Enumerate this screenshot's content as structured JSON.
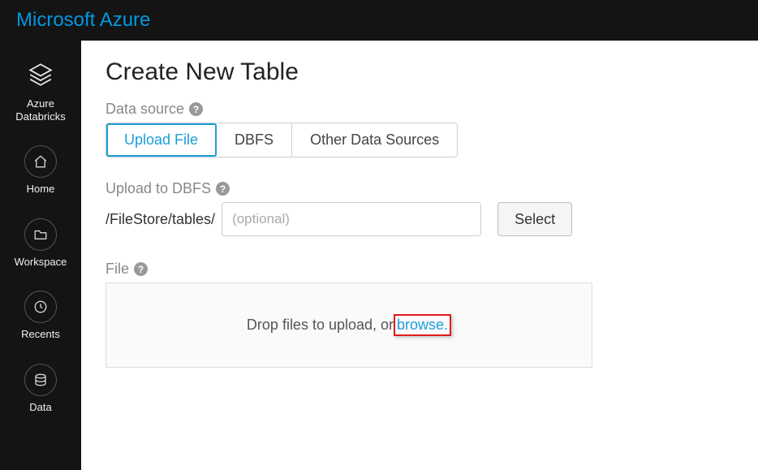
{
  "brand": "Microsoft Azure",
  "sidebar": {
    "items": [
      {
        "label": "Azure\nDatabricks"
      },
      {
        "label": "Home"
      },
      {
        "label": "Workspace"
      },
      {
        "label": "Recents"
      },
      {
        "label": "Data"
      }
    ]
  },
  "main": {
    "title": "Create New Table",
    "data_source_label": "Data source",
    "tabs": [
      "Upload File",
      "DBFS",
      "Other Data Sources"
    ],
    "active_tab": 0,
    "upload_label": "Upload to DBFS",
    "path_prefix": "/FileStore/tables/",
    "path_placeholder": "(optional)",
    "select_button": "Select",
    "file_label": "File",
    "drop_text": "Drop files to upload, or ",
    "browse_text": "browse."
  }
}
